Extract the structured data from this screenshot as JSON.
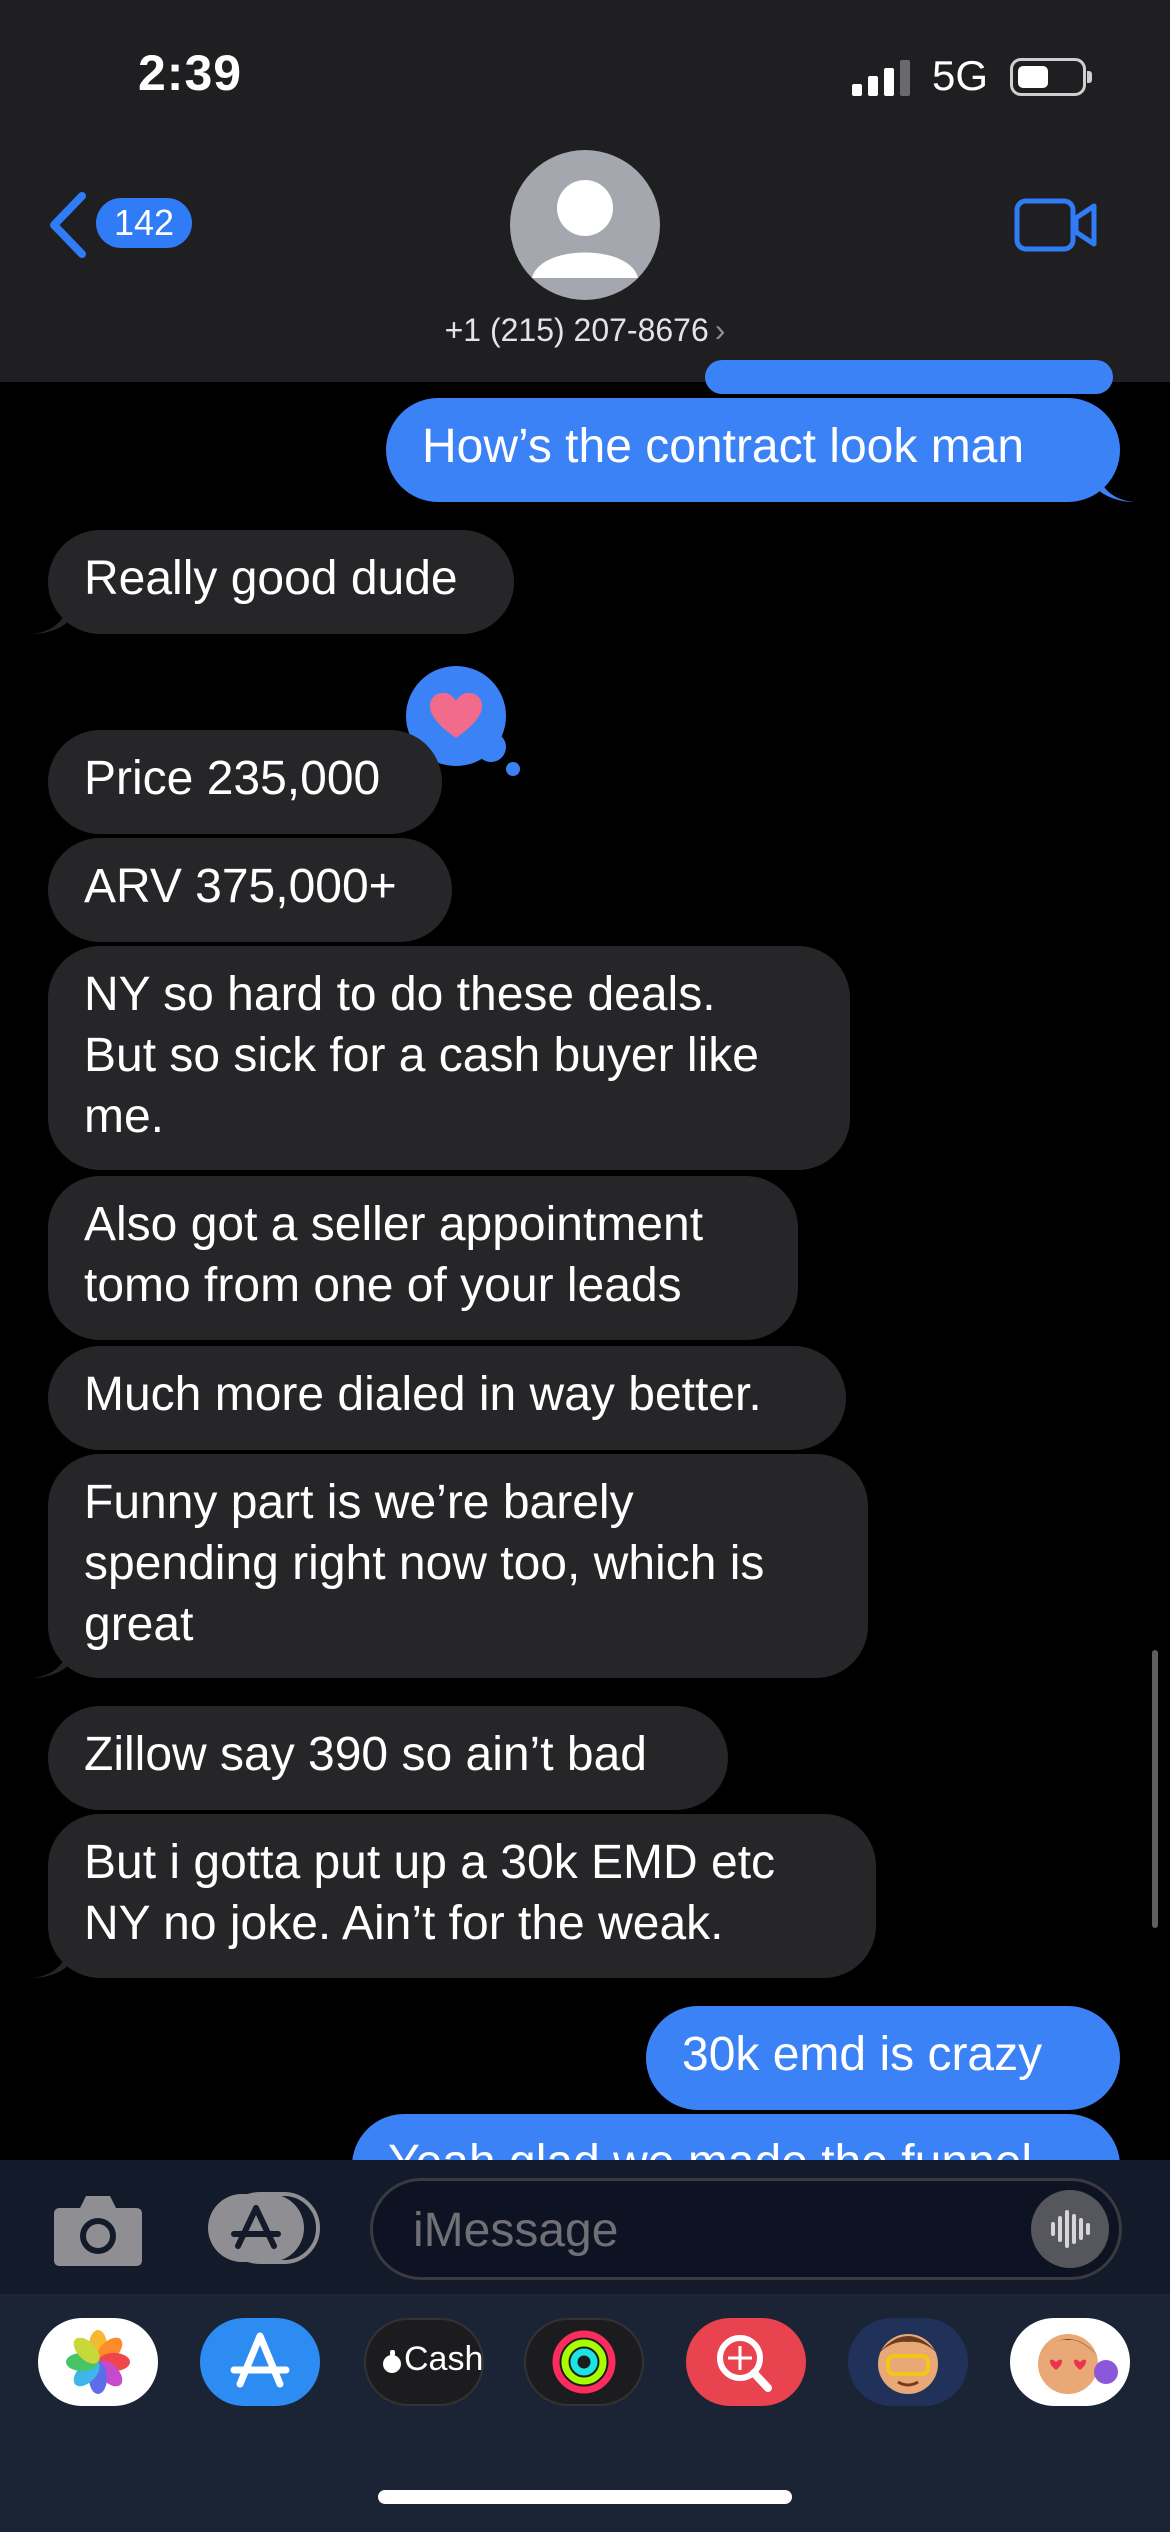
{
  "status_bar": {
    "time": "2:39",
    "network": "5G"
  },
  "nav": {
    "unread_count": "142",
    "contact": "+1 (215) 207-8676",
    "contact_chevron": "›"
  },
  "messages": [
    {
      "from": "me",
      "text": "How’s the contract look man"
    },
    {
      "from": "them",
      "text": "Really good dude"
    },
    {
      "from": "them",
      "text": "Price 235,000",
      "reaction": "heart-icon"
    },
    {
      "from": "them",
      "text": "ARV 375,000+"
    },
    {
      "from": "them",
      "lines": [
        "NY so hard to do these deals.",
        "But so sick for a cash buyer like",
        "me."
      ]
    },
    {
      "from": "them",
      "lines": [
        "Also got a seller appointment",
        "tomo from one of your leads"
      ]
    },
    {
      "from": "them",
      "text": "Much more dialed in way better."
    },
    {
      "from": "them",
      "lines": [
        "Funny part is we’re barely",
        "spending right now too, which is",
        "great"
      ]
    },
    {
      "from": "them",
      "text": "Zillow say 390 so ain’t bad"
    },
    {
      "from": "them",
      "lines": [
        "But i gotta put up a 30k EMD etc",
        "NY no joke. Ain’t for the weak."
      ]
    },
    {
      "from": "me",
      "text": "30k emd is crazy"
    },
    {
      "from": "me",
      "text": "Yeah glad we made the funnel"
    }
  ],
  "compose": {
    "placeholder": "iMessage"
  },
  "app_drawer": [
    {
      "name": "photos",
      "icon": "photos-icon"
    },
    {
      "name": "app-store",
      "icon": "app-store-icon"
    },
    {
      "name": "cash",
      "icon": "cash-app-icon",
      "label": "Cash"
    },
    {
      "name": "activity",
      "icon": "activity-rings-icon"
    },
    {
      "name": "images-search",
      "icon": "images-search-icon"
    },
    {
      "name": "memoji",
      "icon": "memoji-icon"
    },
    {
      "name": "memoji-stickers",
      "icon": "memoji-stickers-icon"
    }
  ],
  "colors": {
    "blue": "#3b82f6",
    "incoming": "#262628",
    "header": "#1f1f21",
    "heart": "#f26b8a"
  }
}
